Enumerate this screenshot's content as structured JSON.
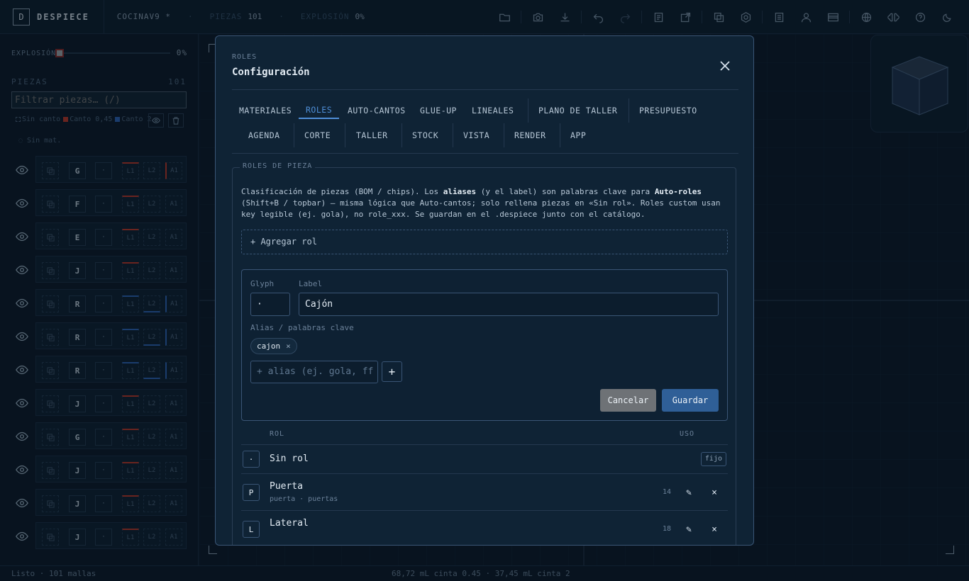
{
  "topbar": {
    "logo_letter": "D",
    "brand": "DESPIECE",
    "project": "COCINAV9 *",
    "pieces_label": "PIEZAS",
    "pieces_count": "101",
    "explosion_label": "EXPLOSIÓN",
    "explosion_value": "0%",
    "icons": [
      "folder-icon",
      "camera-icon",
      "download-icon",
      "undo-icon",
      "redo-icon",
      "cut-list-icon",
      "export-icon",
      "layers-icon",
      "settings-icon",
      "book-icon",
      "user-icon",
      "card-icon",
      "globe-icon",
      "brain-icon",
      "help-icon",
      "moon-icon"
    ]
  },
  "left": {
    "explosion_label": "EXPLOSIÓN",
    "explosion_value": "0%",
    "explosion_fraction": 0,
    "pieces_header": "PIEZAS",
    "pieces_count": "101",
    "filter_placeholder": "Filtrar piezas… (/)",
    "legend": [
      "Sin canto",
      "Canto 0,45",
      "Canto 2"
    ],
    "no_material": "Sin mat.",
    "rows": [
      {
        "glyph": "G",
        "role": "·",
        "l1": "L1",
        "l2": "L2",
        "a1": "A1",
        "l1c": "red",
        "l2c": "",
        "a1c": "red"
      },
      {
        "glyph": "F",
        "role": "·",
        "l1": "L1",
        "l2": "L2",
        "a1": "A1",
        "l1c": "red",
        "l2c": "",
        "a1c": ""
      },
      {
        "glyph": "E",
        "role": "·",
        "l1": "L1",
        "l2": "L2",
        "a1": "A1",
        "l1c": "red",
        "l2c": "",
        "a1c": ""
      },
      {
        "glyph": "J",
        "role": "·",
        "l1": "L1",
        "l2": "L2",
        "a1": "A1",
        "l1c": "red",
        "l2c": "",
        "a1c": ""
      },
      {
        "glyph": "R",
        "role": "·",
        "l1": "L1",
        "l2": "L2",
        "a1": "A1",
        "l1c": "blue",
        "l2c": "blue",
        "a1c": "blue"
      },
      {
        "glyph": "R",
        "role": "·",
        "l1": "L1",
        "l2": "L2",
        "a1": "A1",
        "l1c": "blue",
        "l2c": "blue",
        "a1c": "blue"
      },
      {
        "glyph": "R",
        "role": "·",
        "l1": "L1",
        "l2": "L2",
        "a1": "A1",
        "l1c": "blue",
        "l2c": "blue",
        "a1c": "blue"
      },
      {
        "glyph": "J",
        "role": "·",
        "l1": "L1",
        "l2": "L2",
        "a1": "A1",
        "l1c": "red",
        "l2c": "",
        "a1c": ""
      },
      {
        "glyph": "G",
        "role": "·",
        "l1": "L1",
        "l2": "L2",
        "a1": "A1",
        "l1c": "red",
        "l2c": "",
        "a1c": ""
      },
      {
        "glyph": "J",
        "role": "·",
        "l1": "L1",
        "l2": "L2",
        "a1": "A1",
        "l1c": "red",
        "l2c": "",
        "a1c": ""
      },
      {
        "glyph": "J",
        "role": "·",
        "l1": "L1",
        "l2": "L2",
        "a1": "A1",
        "l1c": "red",
        "l2c": "",
        "a1c": ""
      },
      {
        "glyph": "J",
        "role": "·",
        "l1": "L1",
        "l2": "L2",
        "a1": "A1",
        "l1c": "red",
        "l2c": "",
        "a1c": ""
      }
    ]
  },
  "status": {
    "left": "Listo · 101 mallas",
    "center": "68,72 mL cinta 0.45 · 37,45 mL cinta 2"
  },
  "modal": {
    "subtitle": "ROLES",
    "title": "Configuración",
    "tabs_row1": [
      "MATERIALES",
      "ROLES",
      "AUTO-CANTOS",
      "GLUE-UP",
      "LINEALES",
      "PLANO DE TALLER",
      "PRESUPUESTO"
    ],
    "tabs_row2": [
      "AGENDA",
      "CORTE",
      "TALLER",
      "STOCK",
      "VISTA",
      "RENDER",
      "APP"
    ],
    "active_tab": "ROLES",
    "section_legend": "ROLES DE PIEZA",
    "desc_1": "Clasificación de piezas (BOM / chips). Los ",
    "desc_b1": "aliases",
    "desc_2": " (y el label) son palabras clave para ",
    "desc_b2": "Auto-roles",
    "desc_3": " (Shift+B / topbar) — misma lógica que Auto-cantos; solo rellena piezas en «Sin rol». Roles custom usan key legible (ej. gola), no role_xxx. Se guardan en el .despiece junto con el catálogo.",
    "add_role": "+ Agregar rol",
    "editor": {
      "glyph_label": "Glyph",
      "glyph_value": "·",
      "label_label": "Label",
      "label_value": "Cajón",
      "alias_label": "Alias / palabras clave",
      "chip": "cajon",
      "chip_remove": "×",
      "alias_placeholder": "+ alias (ej. gola, ff",
      "add_alias": "+",
      "cancel": "Cancelar",
      "save": "Guardar"
    },
    "table": {
      "col_role": "ROL",
      "col_use": "USO",
      "rows": [
        {
          "glyph": "·",
          "name": "Sin rol",
          "aliases": "",
          "use": "",
          "badge": "fijo"
        },
        {
          "glyph": "P",
          "name": "Puerta",
          "aliases": "puerta · puertas",
          "use": "14",
          "edit": "✎",
          "delete": "×"
        },
        {
          "glyph": "L",
          "name": "Lateral",
          "aliases": "",
          "use": "18",
          "edit": "✎",
          "delete": "×"
        }
      ]
    }
  }
}
